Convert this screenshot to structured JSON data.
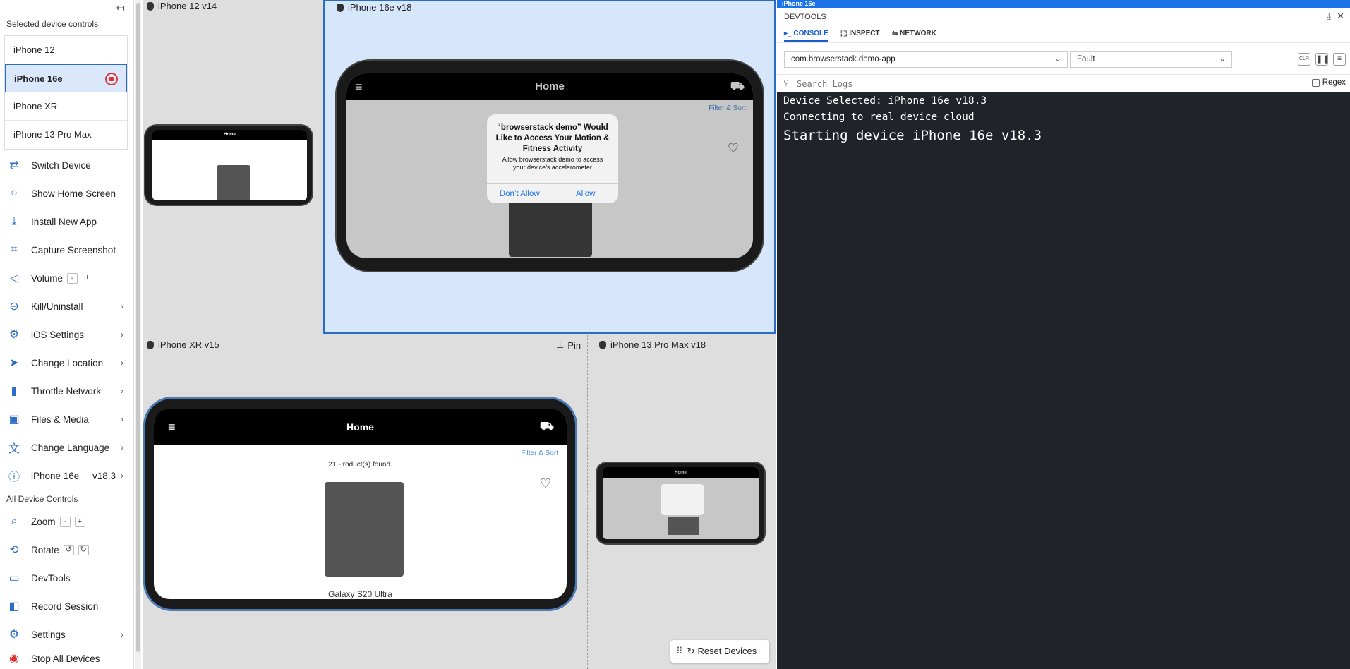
{
  "sidebar": {
    "selected_title": "Selected device controls",
    "devices": [
      "iPhone 12",
      "iPhone 16e",
      "iPhone XR",
      "iPhone 13 Pro Max"
    ],
    "controls": [
      "Switch Device",
      "Show Home Screen",
      "Install New App",
      "Capture Screenshot",
      "Volume",
      "Kill/Uninstall",
      "iOS Settings",
      "Change Location",
      "Throttle Network",
      "Files & Media",
      "Change Language"
    ],
    "device_info": {
      "name": "iPhone 16e",
      "version": "v18.3"
    },
    "volume_minus": "-",
    "volume_plus": "+",
    "all_title": "All Device Controls",
    "all_controls": [
      "Zoom",
      "Rotate",
      "DevTools",
      "Record Session",
      "Settings"
    ],
    "zoom_minus": "-",
    "zoom_plus": "+",
    "stop_all": "Stop All Devices"
  },
  "panels": {
    "p1": "iPhone 12 v14",
    "p2": "iPhone 16e v18",
    "p3": "iPhone XR v15",
    "p4": "iPhone 13 Pro Max v18",
    "pin": "Pin"
  },
  "app": {
    "home": "Home",
    "filter": "Filter & Sort",
    "found": "21 Product(s) found.",
    "alert_title": "“browserstack demo” Would Like to Access Your Motion & Fitness Activity",
    "alert_body": "Allow browserstack demo to access your device’s accelerometer",
    "dont_allow": "Don’t Allow",
    "allow": "Allow",
    "product": "Galaxy S20 Ultra"
  },
  "reset_devices": "Reset Devices",
  "devtools": {
    "bar_title": "iPhone 16e",
    "title": "DEVTOOLS",
    "tabs": [
      "CONSOLE",
      "INSPECT",
      "NETWORK"
    ],
    "app_select": "com.browserstack.demo-app",
    "level_select": "Fault",
    "clr": "CLR",
    "search_placeholder": "Search Logs",
    "regex": "Regex",
    "logs": [
      "Device Selected: iPhone 16e v18.3",
      "Connecting to real device cloud",
      "Starting device iPhone 16e v18.3"
    ]
  }
}
